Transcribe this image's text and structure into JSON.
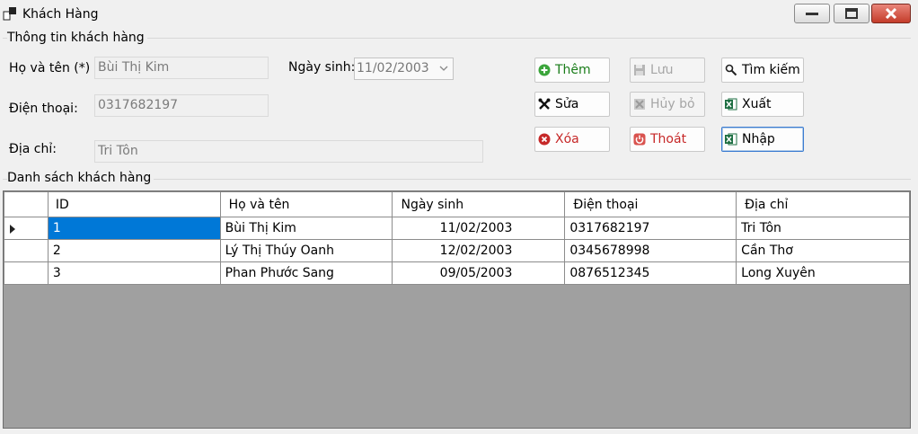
{
  "window": {
    "title": "Khách Hàng"
  },
  "info_group": {
    "legend": "Thông tin khách hàng",
    "name_label": "Họ và tên (*) :",
    "name_value": "Bùi Thị Kim",
    "dob_label": "Ngày sinh:",
    "dob_value": "11/02/2003",
    "phone_label": "Điện thoại:",
    "phone_value": "0317682197",
    "address_label": "Địa chỉ:",
    "address_value": "Tri Tôn"
  },
  "buttons": {
    "add": "Thêm",
    "save": "Lưu",
    "search": "Tìm kiếm",
    "edit": "Sửa",
    "cancel": "Hủy bỏ",
    "export": "Xuất",
    "delete": "Xóa",
    "exit": "Thoát",
    "import": "Nhập"
  },
  "colors": {
    "add": "#1a7d1a",
    "delete": "#c62828",
    "exit": "#c62828",
    "selection": "#0078d7"
  },
  "list_group": {
    "legend": "Danh sách khách hàng",
    "columns": [
      "ID",
      "Họ và tên",
      "Ngày sinh",
      "Điện thoại",
      "Địa chỉ"
    ],
    "rows": [
      [
        "1",
        "Bùi Thị Kim",
        "11/02/2003",
        "0317682197",
        "Tri Tôn"
      ],
      [
        "2",
        "Lý Thị Thúy Oanh",
        "12/02/2003",
        "0345678998",
        "Cần Thơ"
      ],
      [
        "3",
        "Phan Phước Sang",
        "09/05/2003",
        "0876512345",
        "Long Xuyên"
      ]
    ]
  }
}
